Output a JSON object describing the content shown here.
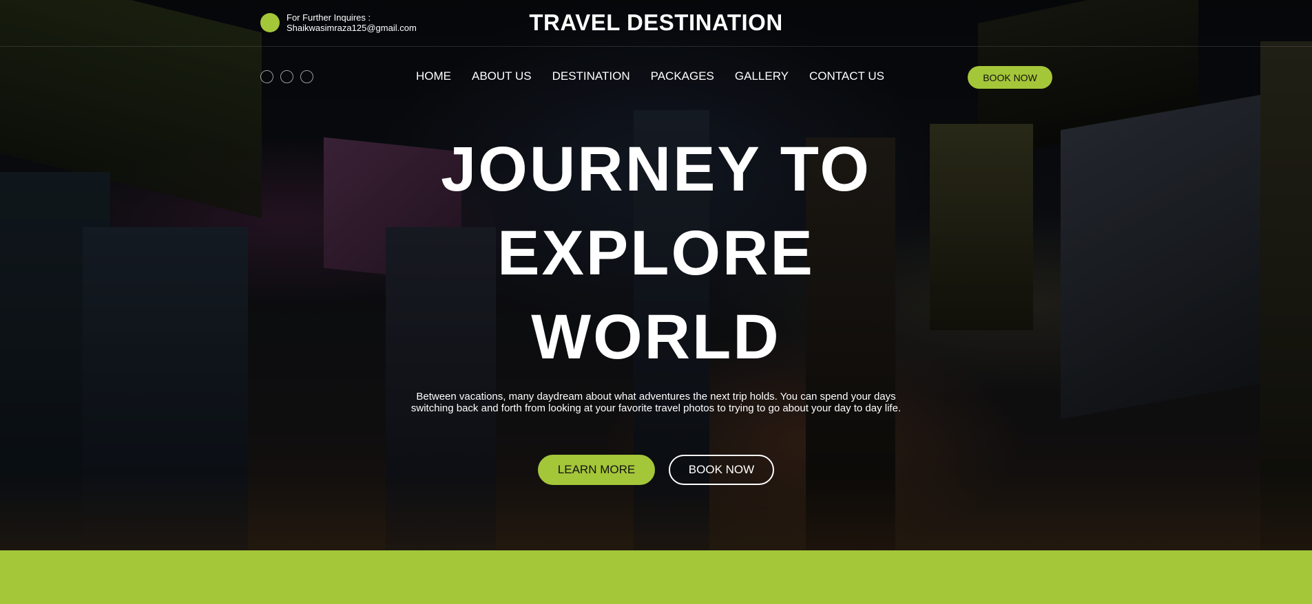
{
  "colors": {
    "accent": "#a4c639",
    "text_light": "#ffffff",
    "text_dark": "#111111"
  },
  "header": {
    "inquiry_label": "For Further Inquires :",
    "inquiry_email": "Shaikwasimraza125@gmail.com",
    "brand_title": "TRAVEL DESTINATION",
    "inquiry_icon": "green-dot-icon"
  },
  "social": {
    "icons": [
      "circle-icon",
      "circle-icon",
      "circle-icon"
    ]
  },
  "nav": {
    "items": [
      "HOME",
      "ABOUT US",
      "DESTINATION",
      "PACKAGES",
      "GALLERY",
      "CONTACT US"
    ],
    "book_now_label": "BOOK NOW"
  },
  "hero": {
    "headline_lines": [
      "JOURNEY TO",
      "EXPLORE",
      "WORLD"
    ],
    "description": "Between vacations, many daydream about what adventures the next trip holds. You can spend your days switching back and forth from looking at your favorite travel photos to trying to go about your day to day life.",
    "learn_more_label": "LEARN MORE",
    "book_now_label": "BOOK NOW"
  }
}
